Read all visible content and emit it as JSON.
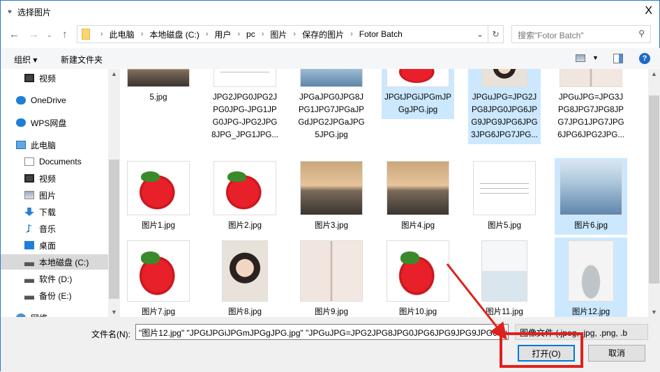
{
  "window": {
    "title": "选择图片",
    "close": "X"
  },
  "nav": {
    "path": [
      "此电脑",
      "本地磁盘 (C:)",
      "用户",
      "pc",
      "图片",
      "保存的图片",
      "Fotor Batch"
    ],
    "search_placeholder": "搜索\"Fotor Batch\""
  },
  "toolbar": {
    "organize": "组织 ▾",
    "new_folder": "新建文件夹",
    "help": "?"
  },
  "sidebar": [
    {
      "label": "视频",
      "icon": "video-icon"
    },
    {
      "label": "OneDrive",
      "icon": "cloud-icon"
    },
    {
      "label": "WPS网盘",
      "icon": "cloud-icon"
    },
    {
      "label": "此电脑",
      "icon": "computer-icon"
    },
    {
      "label": "Documents",
      "icon": "document-icon"
    },
    {
      "label": "视频",
      "icon": "video-icon"
    },
    {
      "label": "图片",
      "icon": "picture-icon"
    },
    {
      "label": "下载",
      "icon": "download-icon"
    },
    {
      "label": "音乐",
      "icon": "music-icon"
    },
    {
      "label": "桌面",
      "icon": "desktop-icon"
    },
    {
      "label": "本地磁盘 (C:)",
      "icon": "drive-icon"
    },
    {
      "label": "软件 (D:)",
      "icon": "drive-icon"
    },
    {
      "label": "备份 (E:)",
      "icon": "drive-icon"
    },
    {
      "label": "网络",
      "icon": "network-icon"
    }
  ],
  "files": [
    {
      "name": "5.jpg",
      "thumb": "sunset",
      "selected": false
    },
    {
      "name": "JPG2JPG0JPG2JPG0JPG-JPG1JPG0JPG-JPG2JPG8JPG_JPG1JPG...",
      "thumb": "doc",
      "selected": false
    },
    {
      "name": "JPGaJPG0JPG8JPG1JPG7JPGaJPGdJPG2JPGaJPG5JPG.jpg",
      "thumb": "boy",
      "selected": false
    },
    {
      "name": "JPGtJPGiJPGmJPGgJPG.jpg",
      "thumb": "straw",
      "selected": true
    },
    {
      "name": "JPGuJPG=JPG2JPG8JPG0JPG6JPG9JPG9JPG6JPG3JPG6JPG7JPG...",
      "thumb": "girl",
      "selected": true
    },
    {
      "name": "JPGuJPG=JPG3JPG8JPG7JPG8JPG7JPG1JPG7JPG6JPG6JPG2JPG...",
      "thumb": "pass",
      "selected": false
    },
    {
      "name": "图片1.jpg",
      "thumb": "straw",
      "selected": false
    },
    {
      "name": "图片2.jpg",
      "thumb": "straw",
      "selected": false
    },
    {
      "name": "图片3.jpg",
      "thumb": "sunset",
      "selected": false
    },
    {
      "name": "图片4.jpg",
      "thumb": "sunset",
      "selected": false
    },
    {
      "name": "图片5.jpg",
      "thumb": "doc",
      "selected": false
    },
    {
      "name": "图片6.jpg",
      "thumb": "boy",
      "selected": true
    },
    {
      "name": "图片7.jpg",
      "thumb": "straw",
      "selected": false
    },
    {
      "name": "图片8.jpg",
      "thumb": "girl",
      "selected": false
    },
    {
      "name": "图片9.jpg",
      "thumb": "pass",
      "selected": false
    },
    {
      "name": "图片10.jpg",
      "thumb": "straw",
      "selected": false
    },
    {
      "name": "图片11.jpg",
      "thumb": "bottle",
      "selected": false
    },
    {
      "name": "图片12.jpg",
      "thumb": "hamster",
      "selected": true
    }
  ],
  "footer": {
    "filename_label": "文件名(N):",
    "filename_value": "\"图片12.jpg\" \"JPGtJPGiJPGmJPGgJPG.jpg\" \"JPGuJPG=JPG2JPG8JPG0JPG6JPG9JPG9JPG6JP",
    "filetype": "图像文件 (.jpeg, .jpg, .png, .b",
    "open": "打开(O)",
    "cancel": "取消"
  },
  "colors": {
    "selection": "#cce8ff",
    "annotation": "#e0201c",
    "accent": "#0078d7"
  }
}
